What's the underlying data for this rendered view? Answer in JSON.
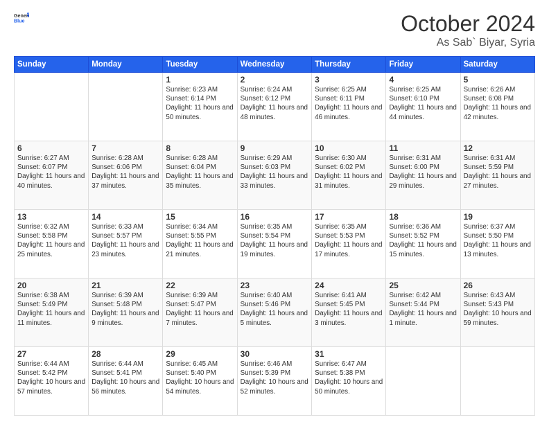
{
  "header": {
    "logo_general": "General",
    "logo_blue": "Blue",
    "title": "October 2024",
    "location": "As Sab` Biyar, Syria"
  },
  "weekdays": [
    "Sunday",
    "Monday",
    "Tuesday",
    "Wednesday",
    "Thursday",
    "Friday",
    "Saturday"
  ],
  "weeks": [
    [
      {
        "day": "",
        "sunrise": "",
        "sunset": "",
        "daylight": ""
      },
      {
        "day": "",
        "sunrise": "",
        "sunset": "",
        "daylight": ""
      },
      {
        "day": "1",
        "sunrise": "Sunrise: 6:23 AM",
        "sunset": "Sunset: 6:14 PM",
        "daylight": "Daylight: 11 hours and 50 minutes."
      },
      {
        "day": "2",
        "sunrise": "Sunrise: 6:24 AM",
        "sunset": "Sunset: 6:12 PM",
        "daylight": "Daylight: 11 hours and 48 minutes."
      },
      {
        "day": "3",
        "sunrise": "Sunrise: 6:25 AM",
        "sunset": "Sunset: 6:11 PM",
        "daylight": "Daylight: 11 hours and 46 minutes."
      },
      {
        "day": "4",
        "sunrise": "Sunrise: 6:25 AM",
        "sunset": "Sunset: 6:10 PM",
        "daylight": "Daylight: 11 hours and 44 minutes."
      },
      {
        "day": "5",
        "sunrise": "Sunrise: 6:26 AM",
        "sunset": "Sunset: 6:08 PM",
        "daylight": "Daylight: 11 hours and 42 minutes."
      }
    ],
    [
      {
        "day": "6",
        "sunrise": "Sunrise: 6:27 AM",
        "sunset": "Sunset: 6:07 PM",
        "daylight": "Daylight: 11 hours and 40 minutes."
      },
      {
        "day": "7",
        "sunrise": "Sunrise: 6:28 AM",
        "sunset": "Sunset: 6:06 PM",
        "daylight": "Daylight: 11 hours and 37 minutes."
      },
      {
        "day": "8",
        "sunrise": "Sunrise: 6:28 AM",
        "sunset": "Sunset: 6:04 PM",
        "daylight": "Daylight: 11 hours and 35 minutes."
      },
      {
        "day": "9",
        "sunrise": "Sunrise: 6:29 AM",
        "sunset": "Sunset: 6:03 PM",
        "daylight": "Daylight: 11 hours and 33 minutes."
      },
      {
        "day": "10",
        "sunrise": "Sunrise: 6:30 AM",
        "sunset": "Sunset: 6:02 PM",
        "daylight": "Daylight: 11 hours and 31 minutes."
      },
      {
        "day": "11",
        "sunrise": "Sunrise: 6:31 AM",
        "sunset": "Sunset: 6:00 PM",
        "daylight": "Daylight: 11 hours and 29 minutes."
      },
      {
        "day": "12",
        "sunrise": "Sunrise: 6:31 AM",
        "sunset": "Sunset: 5:59 PM",
        "daylight": "Daylight: 11 hours and 27 minutes."
      }
    ],
    [
      {
        "day": "13",
        "sunrise": "Sunrise: 6:32 AM",
        "sunset": "Sunset: 5:58 PM",
        "daylight": "Daylight: 11 hours and 25 minutes."
      },
      {
        "day": "14",
        "sunrise": "Sunrise: 6:33 AM",
        "sunset": "Sunset: 5:57 PM",
        "daylight": "Daylight: 11 hours and 23 minutes."
      },
      {
        "day": "15",
        "sunrise": "Sunrise: 6:34 AM",
        "sunset": "Sunset: 5:55 PM",
        "daylight": "Daylight: 11 hours and 21 minutes."
      },
      {
        "day": "16",
        "sunrise": "Sunrise: 6:35 AM",
        "sunset": "Sunset: 5:54 PM",
        "daylight": "Daylight: 11 hours and 19 minutes."
      },
      {
        "day": "17",
        "sunrise": "Sunrise: 6:35 AM",
        "sunset": "Sunset: 5:53 PM",
        "daylight": "Daylight: 11 hours and 17 minutes."
      },
      {
        "day": "18",
        "sunrise": "Sunrise: 6:36 AM",
        "sunset": "Sunset: 5:52 PM",
        "daylight": "Daylight: 11 hours and 15 minutes."
      },
      {
        "day": "19",
        "sunrise": "Sunrise: 6:37 AM",
        "sunset": "Sunset: 5:50 PM",
        "daylight": "Daylight: 11 hours and 13 minutes."
      }
    ],
    [
      {
        "day": "20",
        "sunrise": "Sunrise: 6:38 AM",
        "sunset": "Sunset: 5:49 PM",
        "daylight": "Daylight: 11 hours and 11 minutes."
      },
      {
        "day": "21",
        "sunrise": "Sunrise: 6:39 AM",
        "sunset": "Sunset: 5:48 PM",
        "daylight": "Daylight: 11 hours and 9 minutes."
      },
      {
        "day": "22",
        "sunrise": "Sunrise: 6:39 AM",
        "sunset": "Sunset: 5:47 PM",
        "daylight": "Daylight: 11 hours and 7 minutes."
      },
      {
        "day": "23",
        "sunrise": "Sunrise: 6:40 AM",
        "sunset": "Sunset: 5:46 PM",
        "daylight": "Daylight: 11 hours and 5 minutes."
      },
      {
        "day": "24",
        "sunrise": "Sunrise: 6:41 AM",
        "sunset": "Sunset: 5:45 PM",
        "daylight": "Daylight: 11 hours and 3 minutes."
      },
      {
        "day": "25",
        "sunrise": "Sunrise: 6:42 AM",
        "sunset": "Sunset: 5:44 PM",
        "daylight": "Daylight: 11 hours and 1 minute."
      },
      {
        "day": "26",
        "sunrise": "Sunrise: 6:43 AM",
        "sunset": "Sunset: 5:43 PM",
        "daylight": "Daylight: 10 hours and 59 minutes."
      }
    ],
    [
      {
        "day": "27",
        "sunrise": "Sunrise: 6:44 AM",
        "sunset": "Sunset: 5:42 PM",
        "daylight": "Daylight: 10 hours and 57 minutes."
      },
      {
        "day": "28",
        "sunrise": "Sunrise: 6:44 AM",
        "sunset": "Sunset: 5:41 PM",
        "daylight": "Daylight: 10 hours and 56 minutes."
      },
      {
        "day": "29",
        "sunrise": "Sunrise: 6:45 AM",
        "sunset": "Sunset: 5:40 PM",
        "daylight": "Daylight: 10 hours and 54 minutes."
      },
      {
        "day": "30",
        "sunrise": "Sunrise: 6:46 AM",
        "sunset": "Sunset: 5:39 PM",
        "daylight": "Daylight: 10 hours and 52 minutes."
      },
      {
        "day": "31",
        "sunrise": "Sunrise: 6:47 AM",
        "sunset": "Sunset: 5:38 PM",
        "daylight": "Daylight: 10 hours and 50 minutes."
      },
      {
        "day": "",
        "sunrise": "",
        "sunset": "",
        "daylight": ""
      },
      {
        "day": "",
        "sunrise": "",
        "sunset": "",
        "daylight": ""
      }
    ]
  ]
}
